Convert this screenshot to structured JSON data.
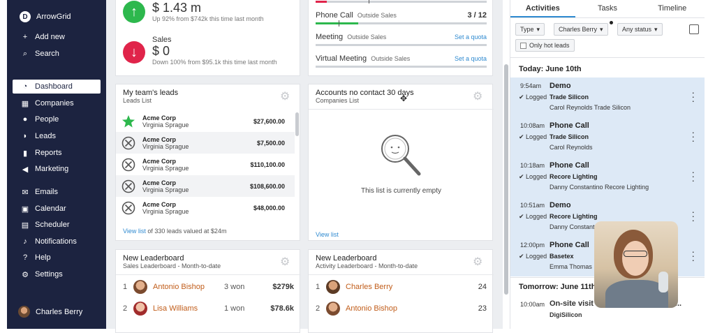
{
  "app": {
    "name": "ArrowGrid",
    "logo_letter": "D"
  },
  "sidebar": {
    "top_items": [
      {
        "label": "Add new",
        "icon": "plus-icon"
      },
      {
        "label": "Search",
        "icon": "search-icon"
      }
    ],
    "items": [
      {
        "label": "Dashboard",
        "icon": "gauge-icon",
        "active": true
      },
      {
        "label": "Companies",
        "icon": "building-icon"
      },
      {
        "label": "People",
        "icon": "person-icon"
      },
      {
        "label": "Leads",
        "icon": "leads-icon"
      },
      {
        "label": "Reports",
        "icon": "bar-chart-icon"
      },
      {
        "label": "Marketing",
        "icon": "megaphone-icon"
      },
      {
        "label": "Emails",
        "icon": "envelope-icon"
      },
      {
        "label": "Calendar",
        "icon": "calendar-icon"
      },
      {
        "label": "Scheduler",
        "icon": "scheduler-icon"
      },
      {
        "label": "Notifications",
        "icon": "bell-icon"
      },
      {
        "label": "Help",
        "icon": "question-icon"
      },
      {
        "label": "Settings",
        "icon": "gear-icon"
      }
    ],
    "user": {
      "name": "Charles Berry"
    }
  },
  "stats": {
    "top": {
      "value": "$ 1.43 m",
      "note": "Up 92% from $742k this time last month"
    },
    "sales": {
      "label": "Sales",
      "value": "$ 0",
      "note": "Down 100% from $95.1k this time last month"
    }
  },
  "quotas": {
    "phone_call": {
      "name": "Phone Call",
      "team": "Outside Sales",
      "count": "3 / 12",
      "progress": 0.25
    },
    "meeting": {
      "name": "Meeting",
      "team": "Outside Sales",
      "link": "Set a quota"
    },
    "virtual_meeting": {
      "name": "Virtual Meeting",
      "team": "Outside Sales",
      "link": "Set a quota"
    }
  },
  "team_leads": {
    "title": "My team's leads",
    "subtitle": "Leads List",
    "rows": [
      {
        "company": "Acme Corp",
        "person": "Virginia Sprague",
        "amount": "$27,600.00",
        "status": "won"
      },
      {
        "company": "Acme Corp",
        "person": "Virginia Sprague",
        "amount": "$7,500.00",
        "status": "lost"
      },
      {
        "company": "Acme Corp",
        "person": "Virginia Sprague",
        "amount": "$110,100.00",
        "status": "lost"
      },
      {
        "company": "Acme Corp",
        "person": "Virginia Sprague",
        "amount": "$108,600.00",
        "status": "lost"
      },
      {
        "company": "Acme Corp",
        "person": "Virginia Sprague",
        "amount": "$48,000.00",
        "status": "lost"
      }
    ],
    "footer_link": "View list",
    "footer_text": " of 330 leads valued at $24m"
  },
  "accounts_no_contact": {
    "title": "Accounts no contact 30 days",
    "subtitle": "Companies List",
    "empty_text": "This list is currently empty",
    "footer_link": "View list"
  },
  "leaderboard_sales": {
    "title": "New Leaderboard",
    "subtitle": "Sales Leaderboard - Month-to-date",
    "rows": [
      {
        "rank": "1",
        "name": "Antonio Bishop",
        "won": "3 won",
        "value": "$279k"
      },
      {
        "rank": "2",
        "name": "Lisa Williams",
        "won": "1 won",
        "value": "$78.6k"
      }
    ]
  },
  "leaderboard_activity": {
    "title": "New Leaderboard",
    "subtitle": "Activity Leaderboard - Month-to-date",
    "rows": [
      {
        "rank": "1",
        "name": "Charles Berry",
        "value": "24"
      },
      {
        "rank": "2",
        "name": "Antonio Bishop",
        "value": "23"
      }
    ]
  },
  "activity_panel": {
    "tabs": [
      "Activities",
      "Tasks",
      "Timeline"
    ],
    "filters": {
      "type": "Type",
      "user": "Charles Berry",
      "status": "Any status",
      "hot_leads": "Only hot leads"
    },
    "today_header": "Today: June 10th",
    "items": [
      {
        "time": "9:54am",
        "title": "Demo",
        "logged": "Logged",
        "company": "Trade Silicon",
        "people": "Carol Reynolds  Trade Silicon"
      },
      {
        "time": "10:08am",
        "title": "Phone Call",
        "logged": "Logged",
        "company": "Trade Silicon",
        "people": "Carol Reynolds"
      },
      {
        "time": "10:18am",
        "title": "Phone Call",
        "logged": "Logged",
        "company": "Recore Lighting",
        "people": "Danny Constantino  Recore Lighting"
      },
      {
        "time": "10:51am",
        "title": "Demo",
        "logged": "Logged",
        "company": "Recore Lighting",
        "people": "Danny Constant"
      },
      {
        "time": "12:00pm",
        "title": "Phone Call",
        "logged": "Logged",
        "company": "Basetex",
        "people": "Emma Thomas"
      }
    ],
    "tomorrow_header": "Tomorrow: June 11th",
    "tomorrow_item": {
      "time": "10:00am",
      "title": "On-site visit at DigiSilicon to show...",
      "company": "DigiSilicon"
    }
  },
  "colors": {
    "sidebar_bg": "#1c2340",
    "accent": "#2f8ad0",
    "up_green": "#2db84d",
    "down_red": "#e0244a",
    "name_orange": "#c15d1a",
    "activity_bg": "#dde9f6"
  }
}
